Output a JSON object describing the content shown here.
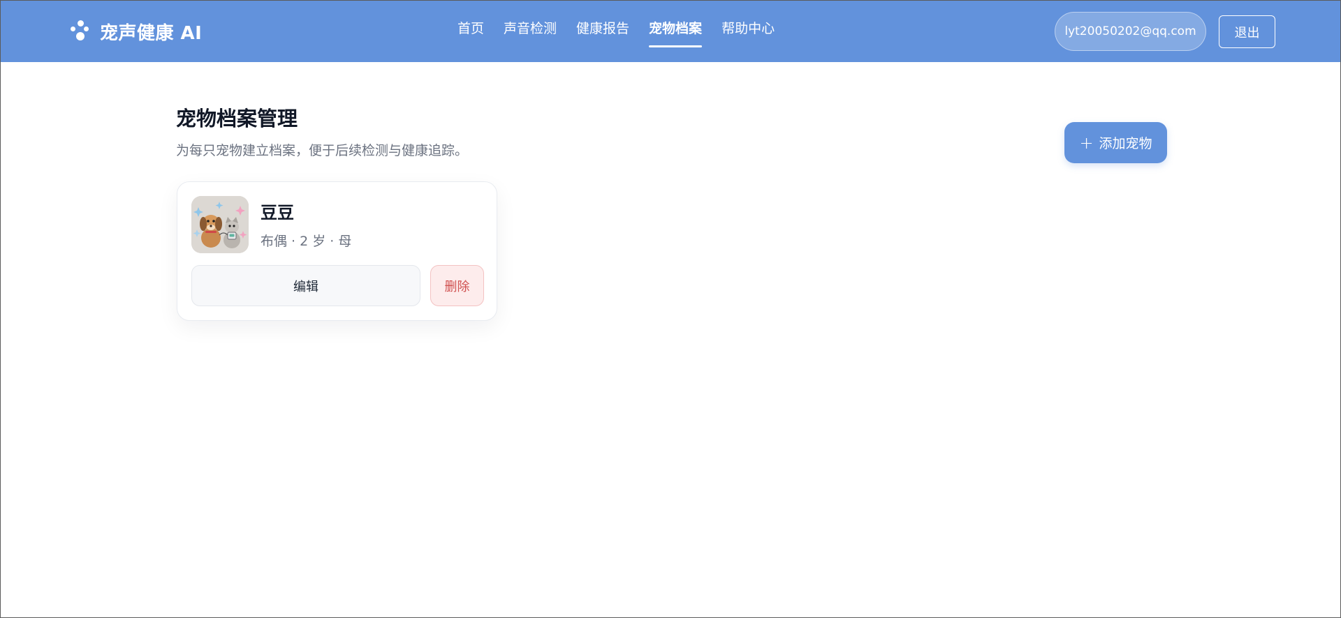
{
  "header": {
    "brand": "宠声健康 AI",
    "nav": [
      {
        "label": "首页",
        "active": false
      },
      {
        "label": "声音检测",
        "active": false
      },
      {
        "label": "健康报告",
        "active": false
      },
      {
        "label": "宠物档案",
        "active": true
      },
      {
        "label": "帮助中心",
        "active": false
      }
    ],
    "user_email": "lyt20050202@qq.com",
    "logout_label": "退出"
  },
  "page": {
    "title": "宠物档案管理",
    "subtitle": "为每只宠物建立档案，便于后续检测与健康追踪。",
    "add_button_icon": "+",
    "add_button_label": "添加宠物"
  },
  "pets": [
    {
      "name": "豆豆",
      "meta": "布偶 · 2 岁 · 母",
      "avatar_icon": "dog-and-cat-avatar",
      "edit_label": "编辑",
      "delete_label": "删除"
    }
  ],
  "colors": {
    "header_bg": "#6292dc",
    "primary": "#6292dc",
    "danger_text": "#d0504f",
    "danger_bg": "#fdecec"
  }
}
